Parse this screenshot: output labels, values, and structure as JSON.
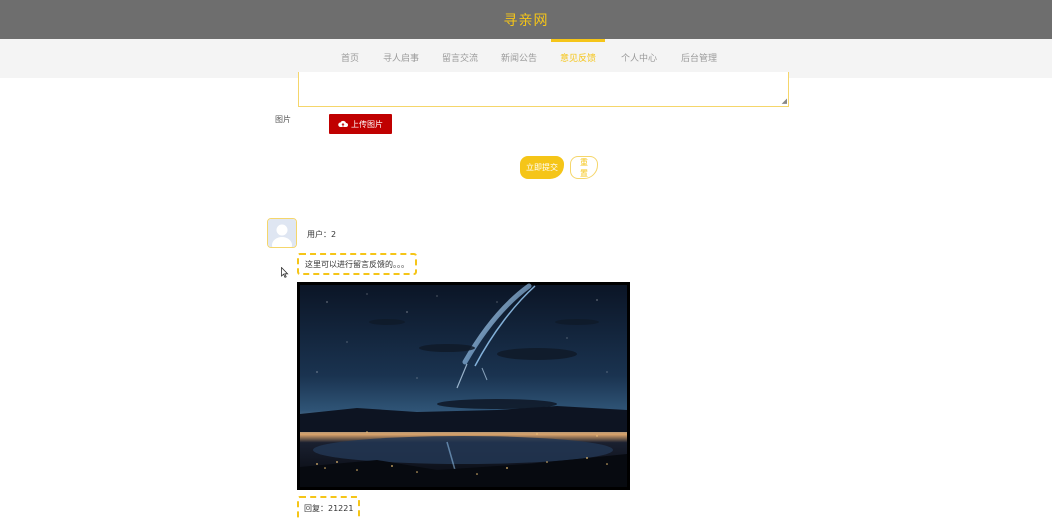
{
  "header": {
    "title": "寻亲网"
  },
  "nav": {
    "items": [
      {
        "label": "首页",
        "active": false
      },
      {
        "label": "寻人启事",
        "active": false
      },
      {
        "label": "留言交流",
        "active": false
      },
      {
        "label": "新闻公告",
        "active": false
      },
      {
        "label": "意见反馈",
        "active": true
      },
      {
        "label": "个人中心",
        "active": false
      },
      {
        "label": "后台管理",
        "active": false
      }
    ]
  },
  "form": {
    "image_label": "图片",
    "upload_label": "上传图片",
    "submit_label": "立即提交",
    "reset_label": "重置"
  },
  "feedback": {
    "user": "用户：2",
    "content": "这里可以进行留言反馈的。。。",
    "reply": "回复：21221"
  },
  "colors": {
    "accent": "#f5c518",
    "header_bg": "#6e6e6e",
    "nav_bg": "#f4f4f4",
    "upload_btn": "#c00000"
  }
}
